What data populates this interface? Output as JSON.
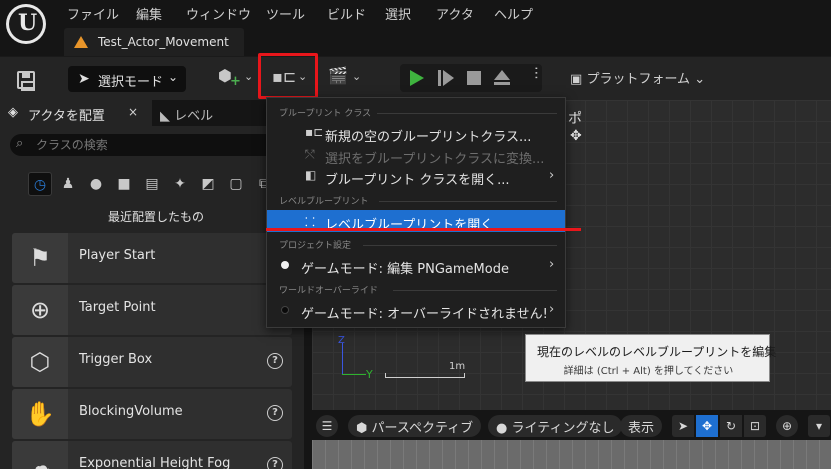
{
  "menu": {
    "logo": "U",
    "items": [
      "ファイル",
      "編集",
      "ウィンドウ",
      "ツール",
      "ビルド",
      "選択",
      "アクタ",
      "ヘルプ"
    ]
  },
  "doc_tab": {
    "title": "Test_Actor_Movement"
  },
  "toolbar": {
    "mode_label": "選択モード",
    "platform_label": "プラットフォーム"
  },
  "left_panel": {
    "tab_place_actors": "アクタを配置",
    "tab_close": "×",
    "tab_levels": "レベル",
    "search_placeholder": "クラスの検索",
    "category_label": "最近配置したもの",
    "items": [
      {
        "name": "Player Start",
        "icon": "flag-gamepad-icon"
      },
      {
        "name": "Target Point",
        "icon": "crosshair-icon"
      },
      {
        "name": "Trigger Box",
        "icon": "trigger-box-icon"
      },
      {
        "name": "BlockingVolume",
        "icon": "blocking-volume-icon"
      },
      {
        "name": "Exponential Height Fog",
        "icon": "fog-icon"
      }
    ]
  },
  "dropdown": {
    "section1": "ブループリント クラス",
    "item_new": "新規の空のブループリントクラス...",
    "item_convert": "選択をブループリントクラスに変換...",
    "item_open_class": "ブループリント クラスを開く...",
    "section2": "レベルブループリント",
    "item_open_level": "レベルブループリントを開く",
    "section3": "プロジェクト設定",
    "item_game_mode": "ゲームモード: 編集 PNGameMode",
    "section4": "ワールドオーバーライド",
    "item_override": "ゲームモード: オーバーライドされません!"
  },
  "tooltip": {
    "title": "現在のレベルのレベルブループリントを編集",
    "subtitle": "詳細は (Ctrl + Alt) を押してください"
  },
  "viewport": {
    "axis_y": "Y",
    "axis_z": "Z",
    "scale": "1m",
    "perspective": "パースペクティブ",
    "lighting": "ライティングなし",
    "show": "表示"
  },
  "colors": {
    "accent_selected": "#1e6fd0",
    "highlight_red": "#e8161b",
    "play_green": "#3fb43f",
    "warning_orange": "#e8952a"
  }
}
